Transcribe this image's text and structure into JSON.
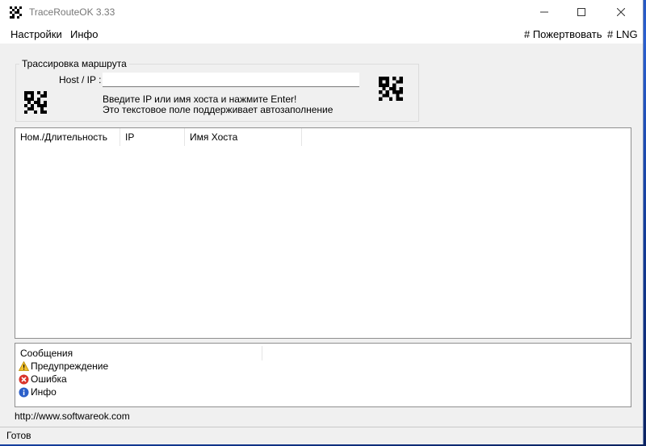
{
  "window": {
    "title": "TraceRouteOK 3.33"
  },
  "menu": {
    "left": [
      "Настройки",
      "Инфо"
    ],
    "donate": "# Пожертвовать",
    "lng": "# LNG"
  },
  "trace_group": {
    "legend": "Трассировка маршрута",
    "host_label": "Host / IP :",
    "host_value": "",
    "hint_line1": "Введите IP или имя хоста и нажмите Enter!",
    "hint_line2": "Это текстовое поле поддерживает автозаполнение"
  },
  "results_table": {
    "columns": [
      "Ном./Длительность",
      "IP",
      "Имя Хоста"
    ],
    "rows": []
  },
  "messages": {
    "header": "Сообщения",
    "items": [
      {
        "type": "warning",
        "label": "Предупреждение",
        "icon": "warning-icon"
      },
      {
        "type": "error",
        "label": "Ошибка",
        "icon": "error-icon"
      },
      {
        "type": "info",
        "label": "Инфо",
        "icon": "info-icon"
      }
    ]
  },
  "link": "http://www.softwareok.com",
  "status": "Готов",
  "colors": {
    "warning": "#f2c12e",
    "error": "#d9342b",
    "info": "#2b5fc9"
  }
}
